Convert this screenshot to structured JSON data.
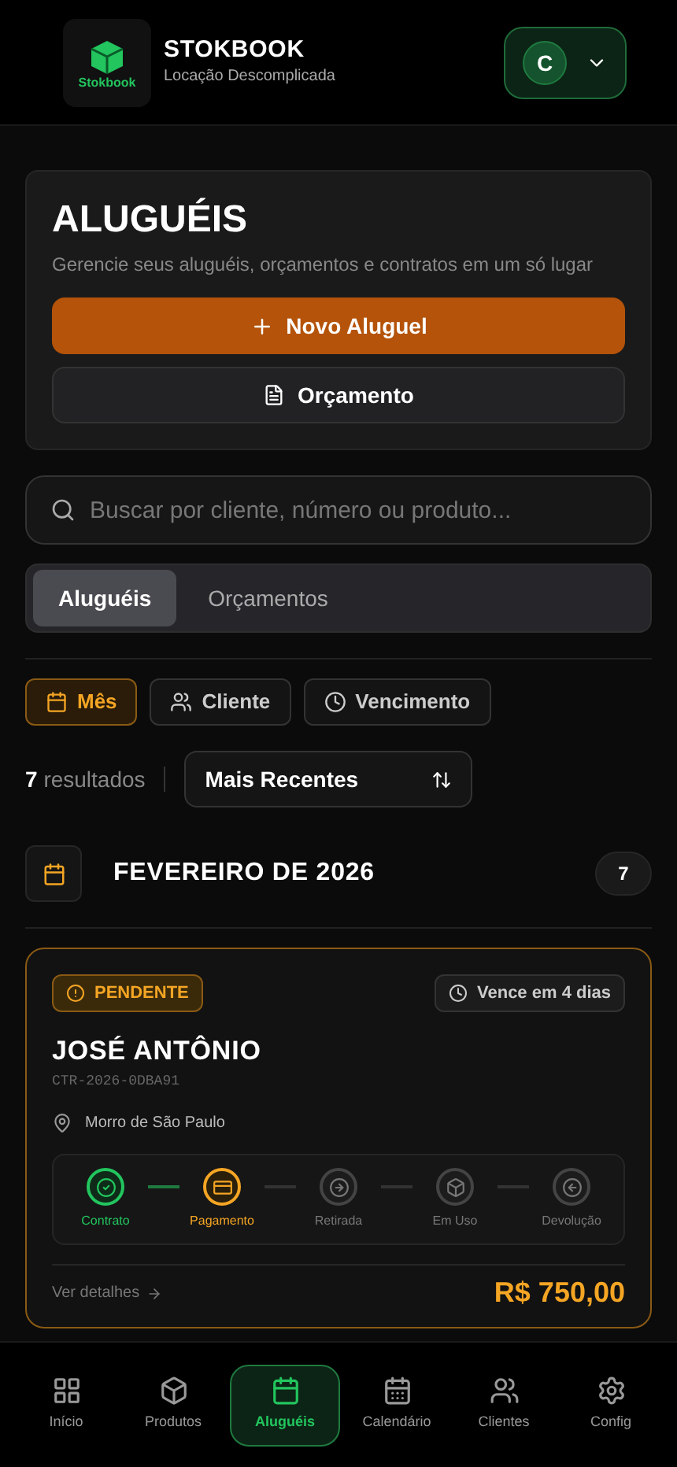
{
  "header": {
    "logo_text": "Stokbook",
    "title": "STOKBOOK",
    "subtitle": "Locação Descomplicada",
    "avatar": "C"
  },
  "hero": {
    "title": "ALUGUÉIS",
    "subtitle": "Gerencie seus aluguéis, orçamentos e contratos em um só lugar",
    "primary_button": "Novo Aluguel",
    "secondary_button": "Orçamento"
  },
  "search": {
    "placeholder": "Buscar por cliente, número ou produto..."
  },
  "tabs": [
    {
      "label": "Aluguéis",
      "selected": true
    },
    {
      "label": "Orçamentos",
      "selected": false
    }
  ],
  "filters": [
    {
      "label": "Mês",
      "kind": "calendar",
      "selected": true
    },
    {
      "label": "Cliente",
      "kind": "users",
      "selected": false
    },
    {
      "label": "Vencimento",
      "kind": "clock",
      "selected": false
    }
  ],
  "results": {
    "count": "7",
    "label": "resultados",
    "sort": "Mais Recentes"
  },
  "group": {
    "title": "FEVEREIRO DE 2026",
    "count": "7"
  },
  "rental": {
    "status": "PENDENTE",
    "due": "Vence em 4 dias",
    "client": "JOSÉ ANTÔNIO",
    "code": "CTR-2026-0DBA91",
    "location": "Morro de São Paulo",
    "steps": [
      {
        "label": "Contrato",
        "kind": "check",
        "done": true,
        "current": false
      },
      {
        "label": "Pagamento",
        "kind": "card",
        "done": false,
        "current": true
      },
      {
        "label": "Retirada",
        "kind": "arrow-right",
        "done": false,
        "current": false
      },
      {
        "label": "Em Uso",
        "kind": "box",
        "done": false,
        "current": false
      },
      {
        "label": "Devolução",
        "kind": "arrow-left",
        "done": false,
        "current": false
      }
    ],
    "details_link": "Ver detalhes",
    "price": "R$ 750,00"
  },
  "nav": [
    {
      "label": "Início",
      "kind": "grid",
      "selected": false
    },
    {
      "label": "Produtos",
      "kind": "box",
      "selected": false
    },
    {
      "label": "Aluguéis",
      "kind": "calendar",
      "selected": true
    },
    {
      "label": "Calendário",
      "kind": "calendar-days",
      "selected": false
    },
    {
      "label": "Clientes",
      "kind": "users",
      "selected": false
    },
    {
      "label": "Config",
      "kind": "gear",
      "selected": false
    }
  ]
}
